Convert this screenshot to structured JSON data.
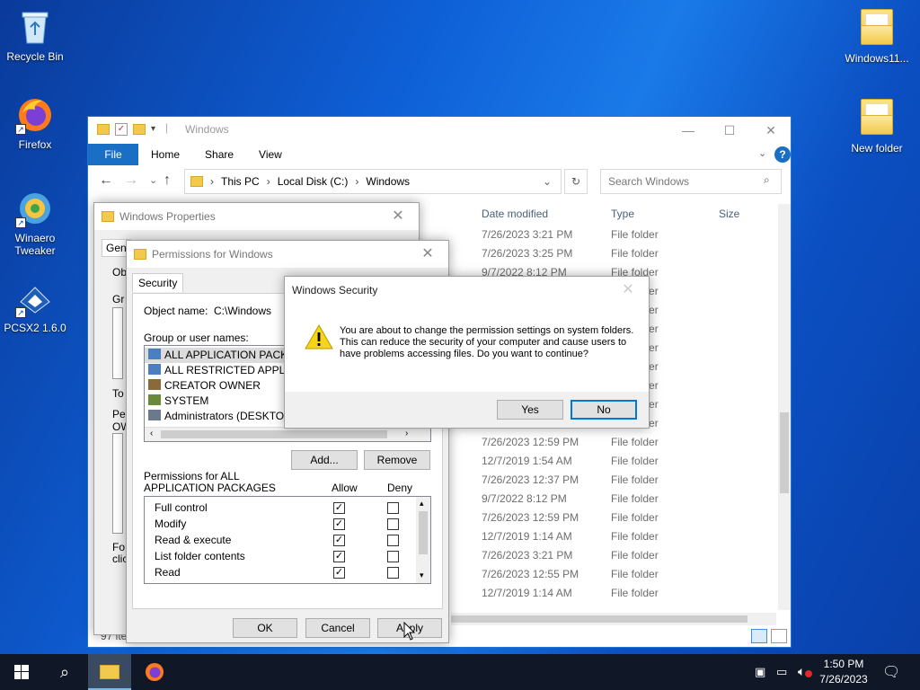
{
  "desktop": {
    "icons": [
      {
        "label": "Recycle Bin"
      },
      {
        "label": "Firefox"
      },
      {
        "label": "Winaero Tweaker"
      },
      {
        "label": "PCSX2 1.6.0"
      },
      {
        "label": "Windows11..."
      },
      {
        "label": "New folder"
      }
    ]
  },
  "explorer": {
    "title": "Windows",
    "ribbon": {
      "file": "File",
      "tabs": [
        "Home",
        "Share",
        "View"
      ]
    },
    "address": {
      "segments": [
        "This PC",
        "Local Disk (C:)",
        "Windows"
      ]
    },
    "search_placeholder": "Search Windows",
    "columns": {
      "date": "Date modified",
      "type": "Type",
      "size": "Size"
    },
    "rows": [
      {
        "date": "7/26/2023 3:21 PM",
        "type": "File folder"
      },
      {
        "date": "7/26/2023 3:25 PM",
        "type": "File folder"
      },
      {
        "date": "9/7/2022 8:12 PM",
        "type": "File folder"
      },
      {
        "date": "",
        "type": "File folder"
      },
      {
        "date": "",
        "type": "File folder"
      },
      {
        "date": "",
        "type": "File folder"
      },
      {
        "date": "",
        "type": "File folder"
      },
      {
        "date": "",
        "type": "File folder"
      },
      {
        "date": "",
        "type": "File folder"
      },
      {
        "date": "",
        "type": "File folder"
      },
      {
        "date": "",
        "type": "File folder"
      },
      {
        "date": "7/26/2023 12:59 PM",
        "type": "File folder"
      },
      {
        "date": "12/7/2019 1:54 AM",
        "type": "File folder"
      },
      {
        "date": "7/26/2023 12:37 PM",
        "type": "File folder"
      },
      {
        "date": "9/7/2022 8:12 PM",
        "type": "File folder"
      },
      {
        "date": "7/26/2023 12:59 PM",
        "type": "File folder"
      },
      {
        "date": "12/7/2019 1:14 AM",
        "type": "File folder"
      },
      {
        "date": "7/26/2023 3:21 PM",
        "type": "File folder"
      },
      {
        "date": "7/26/2023 12:55 PM",
        "type": "File folder"
      },
      {
        "date": "12/7/2019 1:14 AM",
        "type": "File folder"
      }
    ],
    "status_items": "97 ite"
  },
  "properties": {
    "title": "Windows Properties",
    "tab": "Gen",
    "frag_ob": "Ob",
    "frag_gr": "Gr",
    "frag_to": "To",
    "frag_pe": "Pe",
    "frag_ow": "OW",
    "frag_fo": "Fo",
    "frag_cli": "clic"
  },
  "permissions": {
    "title": "Permissions for Windows",
    "tab": "Security",
    "object_label": "Object name:",
    "object_value": "C:\\Windows",
    "group_label": "Group or user names:",
    "users": [
      "ALL APPLICATION PACKAGES",
      "ALL RESTRICTED APPLICATION PACKAGES",
      "CREATOR OWNER",
      "SYSTEM",
      "Administrators (DESKTOP-4"
    ],
    "add_btn": "Add...",
    "remove_btn": "Remove",
    "perm_label_1": "Permissions for ALL",
    "perm_label_2": "APPLICATION PACKAGES",
    "allow": "Allow",
    "deny": "Deny",
    "perms": [
      {
        "name": "Full control",
        "allow": true,
        "deny": false
      },
      {
        "name": "Modify",
        "allow": true,
        "deny": false
      },
      {
        "name": "Read & execute",
        "allow": true,
        "deny": false
      },
      {
        "name": "List folder contents",
        "allow": true,
        "deny": false
      },
      {
        "name": "Read",
        "allow": true,
        "deny": false
      }
    ],
    "ok": "OK",
    "cancel": "Cancel",
    "apply": "Apply"
  },
  "security": {
    "title": "Windows Security",
    "message": "You are about to change the permission settings on system folders. This can reduce the security of your computer and cause users to have problems accessing files. Do you want to continue?",
    "yes": "Yes",
    "no": "No"
  },
  "taskbar": {
    "time": "1:50 PM",
    "date": "7/26/2023"
  }
}
